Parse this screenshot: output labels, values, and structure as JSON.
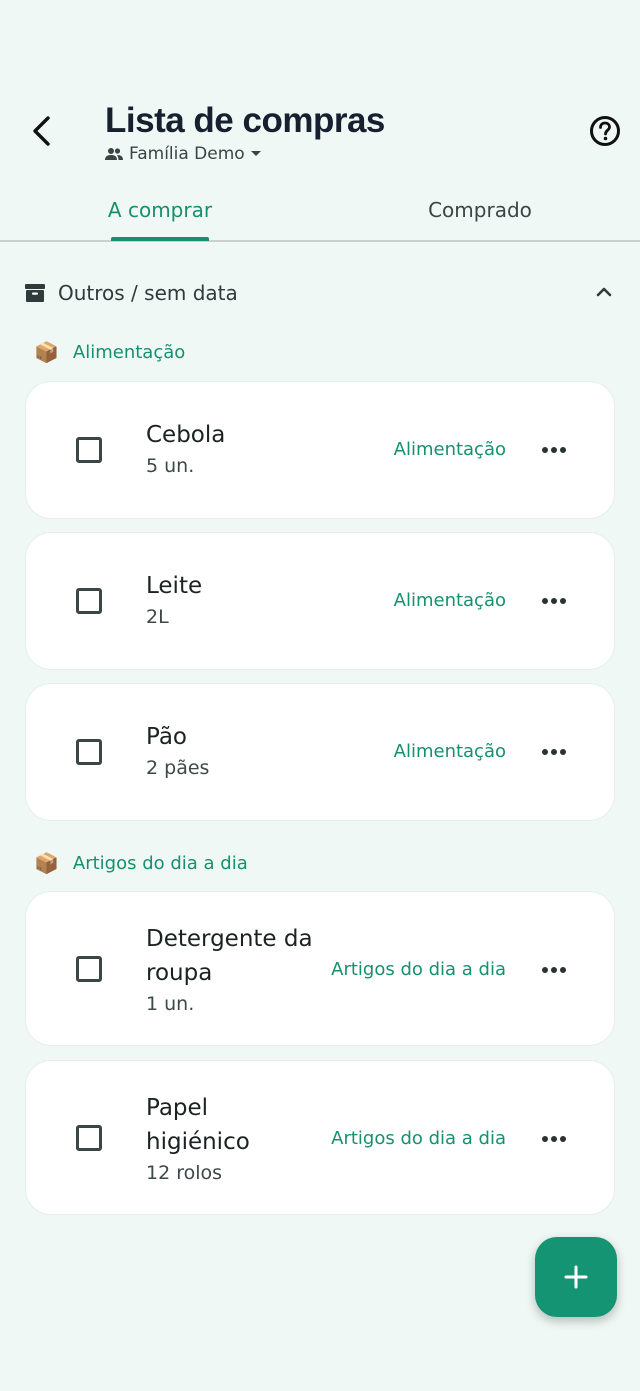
{
  "header": {
    "title": "Lista de compras",
    "family": "Família Demo"
  },
  "tabs": [
    {
      "label": "A comprar",
      "active": true
    },
    {
      "label": "Comprado",
      "active": false
    }
  ],
  "section": {
    "title": "Outros / sem data",
    "expanded": true
  },
  "groups": [
    {
      "label": "Alimentação",
      "emoji": "📦",
      "items": [
        {
          "name": "Cebola",
          "qty": "5 un.",
          "category": "Alimentação"
        },
        {
          "name": "Leite",
          "qty": "2L",
          "category": "Alimentação"
        },
        {
          "name": "Pão",
          "qty": "2 pães",
          "category": "Alimentação"
        }
      ]
    },
    {
      "label": "Artigos do dia a dia",
      "emoji": "📦",
      "items": [
        {
          "name": "Detergente da roupa",
          "qty": "1 un.",
          "category": "Artigos do dia a dia"
        },
        {
          "name": "Papel higiénico",
          "qty": "12 rolos",
          "category": "Artigos do dia a dia"
        }
      ]
    }
  ],
  "colors": {
    "accent": "#17906d",
    "background": "#eff8f5",
    "fab": "#159474"
  },
  "icons": {
    "back": "arrow-left-icon",
    "help": "help-circle-icon",
    "family": "people-icon",
    "dropdown": "caret-down-icon",
    "section": "archive-icon",
    "collapse": "chevron-up-icon",
    "more": "more-horizontal-icon",
    "add": "plus-icon"
  }
}
